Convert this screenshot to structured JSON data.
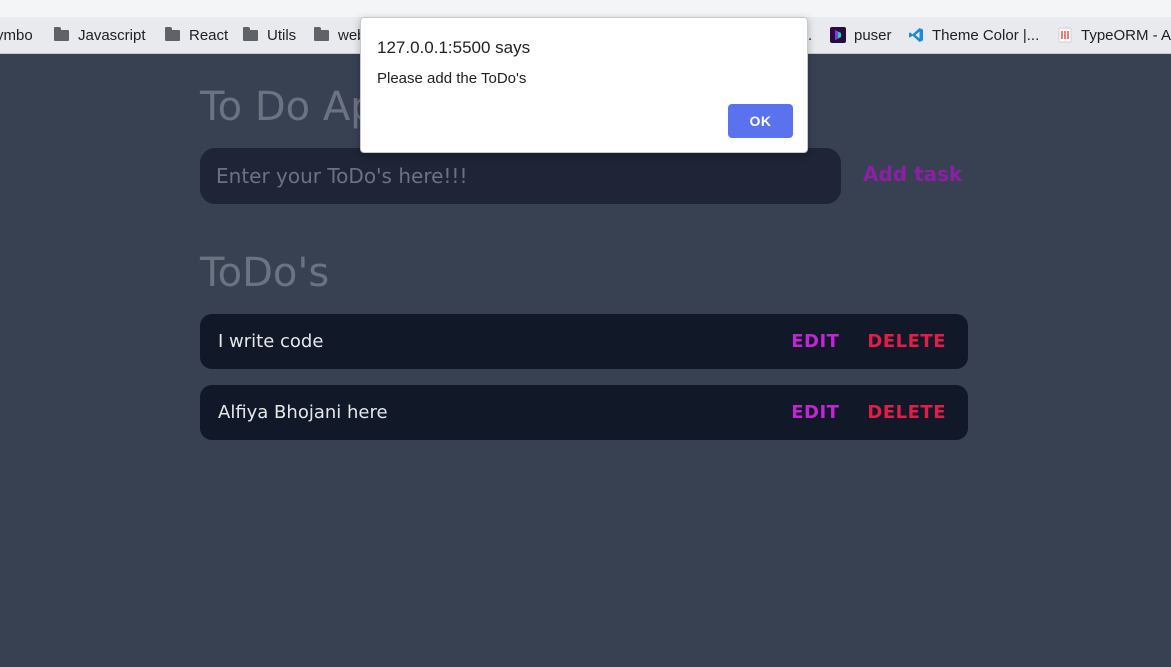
{
  "bookmarks": [
    {
      "label": "ymbo",
      "icon": "folder-icon"
    },
    {
      "label": "Javascript",
      "icon": "folder-icon"
    },
    {
      "label": "React",
      "icon": "folder-icon"
    },
    {
      "label": "Utils",
      "icon": "folder-icon"
    },
    {
      "label": "web",
      "icon": "folder-icon"
    },
    {
      "label": ".",
      "icon": ""
    },
    {
      "label": "puser",
      "icon": "puser-favicon"
    },
    {
      "label": "Theme Color |...",
      "icon": "vscode-favicon"
    },
    {
      "label": "TypeORM - Ar",
      "icon": "typeorm-favicon"
    }
  ],
  "app": {
    "title": "To Do App",
    "input_placeholder": "Enter your ToDo's here!!!",
    "input_value": "",
    "add_label": "Add task",
    "list_title": "ToDo's",
    "todos": [
      {
        "text": "I write code",
        "edit_label": "EDIT",
        "delete_label": "DELETE"
      },
      {
        "text": "Alfiya Bhojani here",
        "edit_label": "EDIT",
        "delete_label": "DELETE"
      }
    ]
  },
  "alert": {
    "origin": "127.0.0.1:5500 says",
    "message": "Please add the ToDo's",
    "ok_label": "OK"
  },
  "colors": {
    "background": "#374151",
    "input_bg": "#1f2536",
    "row_bg": "#111827",
    "add_task": "#8b1fa6",
    "edit": "#c026d3",
    "delete": "#e11d48",
    "ok_button": "#5b72ee"
  }
}
